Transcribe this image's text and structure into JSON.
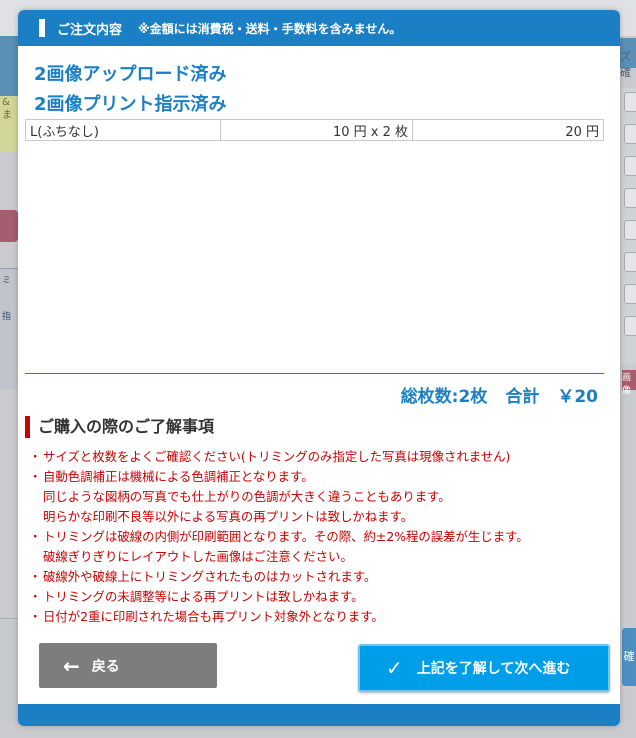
{
  "header": {
    "title": "ご注文内容",
    "note": "※金額には消費税・送料・手数料を含みません。"
  },
  "status": {
    "uploaded": "2画像アップロード済み",
    "printed": "2画像プリント指示済み"
  },
  "order_items": [
    {
      "size": "L(ふちなし)",
      "price_qty": "10 円 x 2 枚",
      "subtotal": "20 円"
    }
  ],
  "totals": {
    "count_label": "総枚数:2枚",
    "total_label": "合計",
    "total_value": "￥20"
  },
  "notes": {
    "title": "ご購入の際のご了解事項",
    "lines": [
      "サイズと枚数をよくご確認ください(トリミングのみ指定した写真は現像されません)",
      "自動色調補正は機械による色調補正となります。",
      "同じような図柄の写真でも仕上がりの色調が大きく違うこともあります。",
      "明らかな印刷不良等以外による写真の再プリントは致しかねます。",
      "トリミングは破線の内側が印刷範囲となります。その際、約±2%程の誤差が生じます。",
      "破線ぎりぎりにレイアウトした画像はご注意ください。",
      "破線外や破線上にトリミングされたものはカットされます。",
      "トリミングの未調整等による再プリントは致しかねます。",
      "日付が2重に印刷された場合も再プリント対象外となります。"
    ]
  },
  "buttons": {
    "back": "戻る",
    "next": "上記を了解して次へ進む"
  },
  "background": {
    "left_note": "&ま",
    "right_text": "ズ確",
    "left_list_1": "ミ",
    "left_list_2": "指",
    "right_red": "画像",
    "right_btn": "確"
  },
  "colors": {
    "accent": "#1a7fc4",
    "warning": "#cc0000",
    "next_button": "#009ee8",
    "back_button": "#7d7d7d"
  }
}
